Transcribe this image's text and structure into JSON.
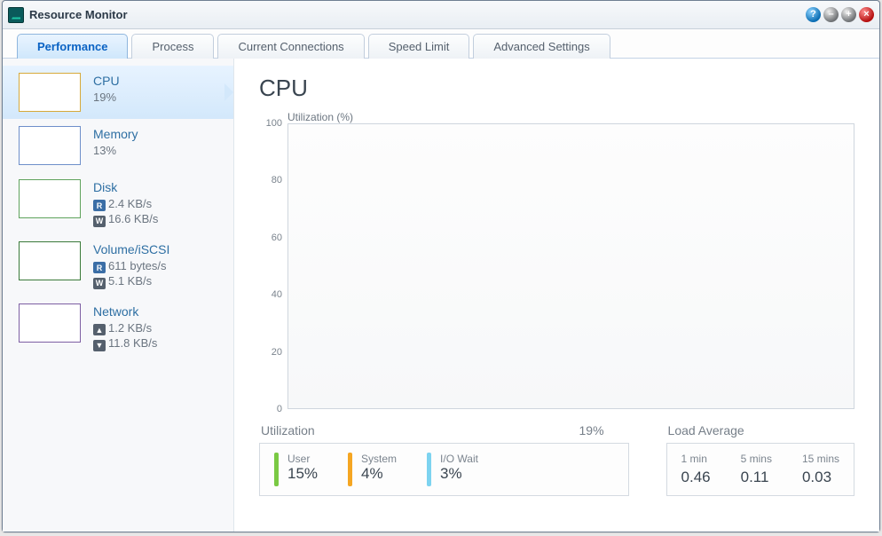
{
  "window": {
    "title": "Resource Monitor"
  },
  "tabs": [
    {
      "label": "Performance"
    },
    {
      "label": "Process"
    },
    {
      "label": "Current Connections"
    },
    {
      "label": "Speed Limit"
    },
    {
      "label": "Advanced Settings"
    }
  ],
  "sidebar": {
    "items": [
      {
        "title": "CPU",
        "line1": "19%",
        "line2": ""
      },
      {
        "title": "Memory",
        "line1": "13%",
        "line2": ""
      },
      {
        "title": "Disk",
        "r": "2.4 KB/s",
        "w": "16.6 KB/s"
      },
      {
        "title": "Volume/iSCSI",
        "r": "611 bytes/s",
        "w": "5.1 KB/s"
      },
      {
        "title": "Network",
        "up": "1.2 KB/s",
        "down": "11.8 KB/s"
      }
    ]
  },
  "main": {
    "heading": "CPU",
    "chart_label": "Utilization (%)",
    "utilization_header": "Utilization",
    "utilization_total": "19%",
    "util": [
      {
        "label": "User",
        "value": "15%"
      },
      {
        "label": "System",
        "value": "4%"
      },
      {
        "label": "I/O Wait",
        "value": "3%"
      }
    ],
    "load_header": "Load Average",
    "load": [
      {
        "label": "1 min",
        "value": "0.46"
      },
      {
        "label": "5 mins",
        "value": "0.11"
      },
      {
        "label": "15 mins",
        "value": "0.03"
      }
    ]
  },
  "chart_data": {
    "type": "line",
    "ylabel": "Utilization (%)",
    "ylim": [
      0,
      100
    ],
    "y_ticks": [
      0,
      20,
      40,
      60,
      80,
      100
    ],
    "series": [
      {
        "name": "CPU",
        "values": []
      }
    ]
  }
}
